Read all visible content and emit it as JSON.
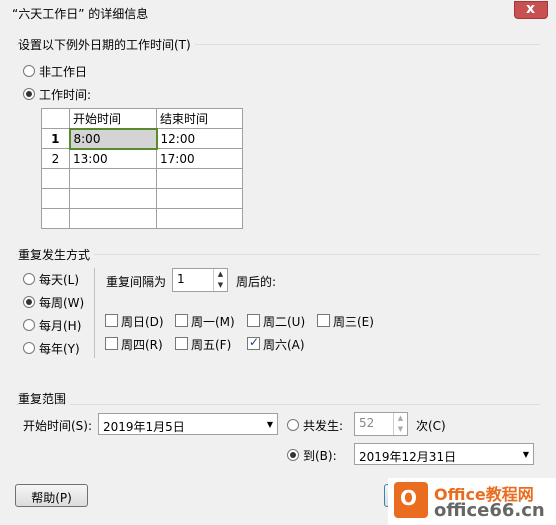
{
  "window": {
    "title": "“六天工作日” 的详细信息",
    "close": "x"
  },
  "exception_group": {
    "title": "设置以下例外日期的工作时间(T)",
    "nonworking_label": "非工作日",
    "working_label": "工作时间:",
    "selected": "working"
  },
  "time_table": {
    "headers": [
      "开始时间",
      "结束时间"
    ],
    "rows": [
      {
        "num": "1",
        "start": "8:00",
        "end": "12:00"
      },
      {
        "num": "2",
        "start": "13:00",
        "end": "17:00"
      },
      {
        "num": "",
        "start": "",
        "end": ""
      },
      {
        "num": "",
        "start": "",
        "end": ""
      },
      {
        "num": "",
        "start": "",
        "end": ""
      }
    ]
  },
  "recurrence": {
    "title": "重复发生方式",
    "options": [
      "每天(L)",
      "每周(W)",
      "每月(H)",
      "每年(Y)"
    ],
    "selected": "每周(W)",
    "interval_label": "重复间隔为",
    "interval_value": "1",
    "interval_suffix": "周后的:",
    "days": [
      {
        "label": "周日(D)",
        "checked": false
      },
      {
        "label": "周一(M)",
        "checked": false
      },
      {
        "label": "周二(U)",
        "checked": false
      },
      {
        "label": "周三(E)",
        "checked": false
      },
      {
        "label": "周四(R)",
        "checked": false
      },
      {
        "label": "周五(F)",
        "checked": false
      },
      {
        "label": "周六(A)",
        "checked": true
      }
    ]
  },
  "range": {
    "title": "重复范围",
    "start_label": "开始时间(S):",
    "start_value": "2019年1月5日",
    "occurrences_label": "共发生:",
    "occurrences_value": "52",
    "occurrences_suffix": "次(C)",
    "end_label": "到(B):",
    "end_value": "2019年12月31日",
    "selected": "end_by"
  },
  "buttons": {
    "help": "帮助(P)"
  },
  "watermark": {
    "line1": "Office教程网",
    "line2": "office66.cn"
  }
}
